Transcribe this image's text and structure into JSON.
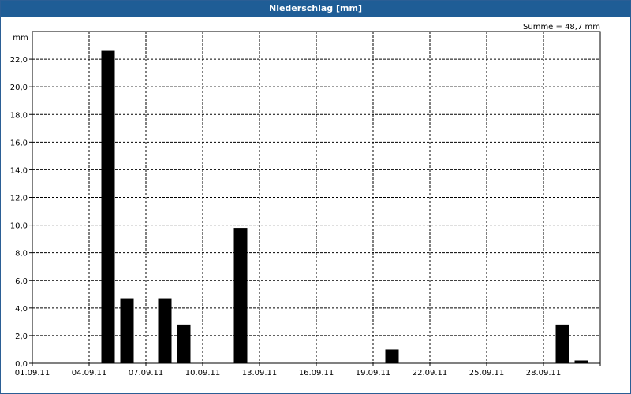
{
  "window": {
    "title": "Niederschlag [mm]"
  },
  "chart_data": {
    "type": "bar",
    "title": "Niederschlag [mm]",
    "ylabel": "mm",
    "summary": "Summe = 48,7 mm",
    "ylim": [
      0,
      24
    ],
    "yticks": [
      "0,0",
      "2,0",
      "4,0",
      "6,0",
      "8,0",
      "10,0",
      "12,0",
      "14,0",
      "16,0",
      "18,0",
      "20,0",
      "22,0"
    ],
    "xticks": [
      "01.09.11",
      "04.09.11",
      "07.09.11",
      "10.09.11",
      "13.09.11",
      "16.09.11",
      "19.09.11",
      "22.09.11",
      "25.09.11",
      "28.09.11"
    ],
    "categories": [
      "01.09.11",
      "02.09.11",
      "03.09.11",
      "04.09.11",
      "05.09.11",
      "06.09.11",
      "07.09.11",
      "08.09.11",
      "09.09.11",
      "10.09.11",
      "11.09.11",
      "12.09.11",
      "13.09.11",
      "14.09.11",
      "15.09.11",
      "16.09.11",
      "17.09.11",
      "18.09.11",
      "19.09.11",
      "20.09.11",
      "21.09.11",
      "22.09.11",
      "23.09.11",
      "24.09.11",
      "25.09.11",
      "26.09.11",
      "27.09.11",
      "28.09.11",
      "29.09.11",
      "30.09.11"
    ],
    "values": [
      0,
      0,
      0,
      22.6,
      4.7,
      0,
      4.7,
      2.8,
      0,
      0,
      9.8,
      0,
      0,
      0,
      0,
      0,
      0,
      0,
      1.0,
      0,
      0,
      0,
      0,
      0,
      0,
      0,
      0,
      2.8,
      0.2,
      0
    ],
    "bar_color": "#000000",
    "grid": true
  }
}
